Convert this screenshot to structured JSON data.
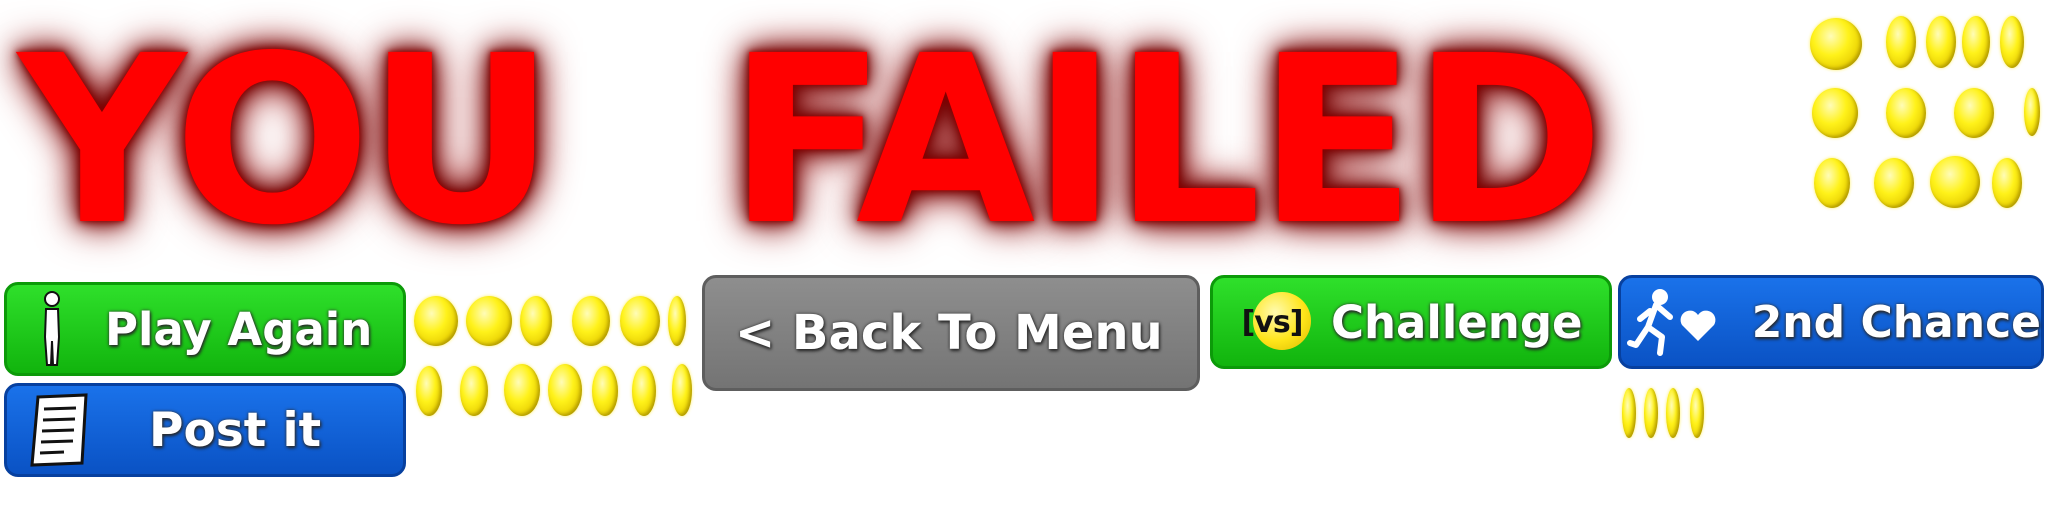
{
  "title": {
    "word1": "YOU",
    "word2": "FAILED"
  },
  "buttons": {
    "play_again": "Play Again",
    "post_it": "Post it",
    "back_to_menu": "< Back To Menu",
    "challenge": "Challenge",
    "challenge_badge": "[vs]",
    "second_chance": "2nd Chance"
  },
  "icons": {
    "play_again": "stick-figure-icon",
    "post_it": "paper-note-icon",
    "challenge": "versus-ball-icon",
    "second_chance": "running-figure-heart-icon",
    "decoration": "gold-coin-icon"
  },
  "colors": {
    "title_red": "#ff0000",
    "green_button": "#1ccb17",
    "blue_button": "#0d5fd6",
    "gray_button": "#808080",
    "coin_yellow": "#fff21a"
  }
}
